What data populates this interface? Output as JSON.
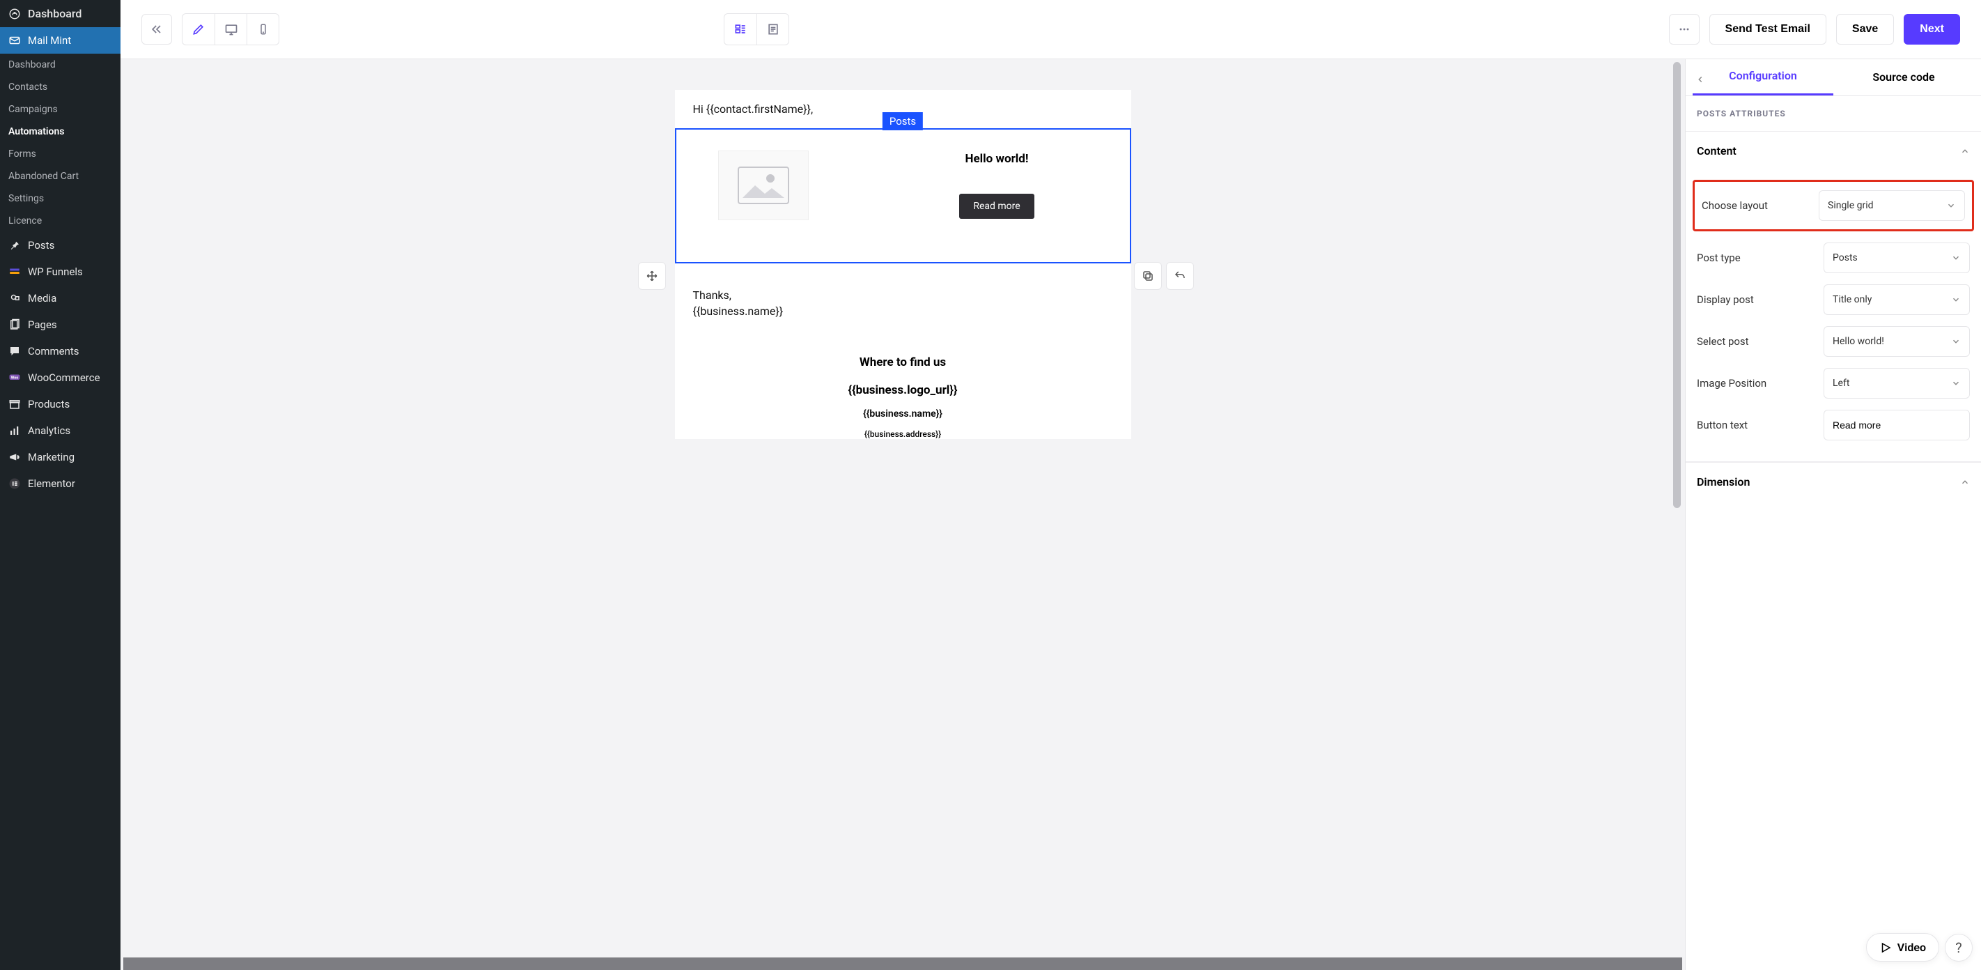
{
  "sidebar": {
    "top": "Dashboard",
    "parent": "Mail Mint",
    "subs": [
      "Dashboard",
      "Contacts",
      "Campaigns",
      "Automations",
      "Forms",
      "Abandoned Cart",
      "Settings",
      "Licence"
    ],
    "active_sub": 3,
    "items": [
      "Posts",
      "WP Funnels",
      "Media",
      "Pages",
      "Comments",
      "WooCommerce",
      "Products",
      "Analytics",
      "Marketing",
      "Elementor"
    ]
  },
  "topbar": {
    "send_test": "Send Test Email",
    "save": "Save",
    "next": "Next"
  },
  "canvas": {
    "greeting": "Hi {{contact.firstName}},",
    "block_label": "Posts",
    "post_title": "Hello world!",
    "read_more": "Read more",
    "thanks": "Thanks,",
    "business": "{{business.name}}",
    "footer_head": "Where to find us",
    "footer_logo": "{{business.logo_url}}",
    "footer_name": "{{business.name}}",
    "footer_addr": "{{business.address}}"
  },
  "panel": {
    "tab_config": "Configuration",
    "tab_source": "Source code",
    "section": "POSTS ATTRIBUTES",
    "acc_content": "Content",
    "acc_dimension": "Dimension",
    "rows": {
      "layout_label": "Choose layout",
      "layout_value": "Single grid",
      "posttype_label": "Post type",
      "posttype_value": "Posts",
      "display_label": "Display post",
      "display_value": "Title only",
      "selectpost_label": "Select post",
      "selectpost_value": "Hello world!",
      "imgpos_label": "Image Position",
      "imgpos_value": "Left",
      "btntext_label": "Button text",
      "btntext_value": "Read more"
    },
    "video": "Video"
  }
}
